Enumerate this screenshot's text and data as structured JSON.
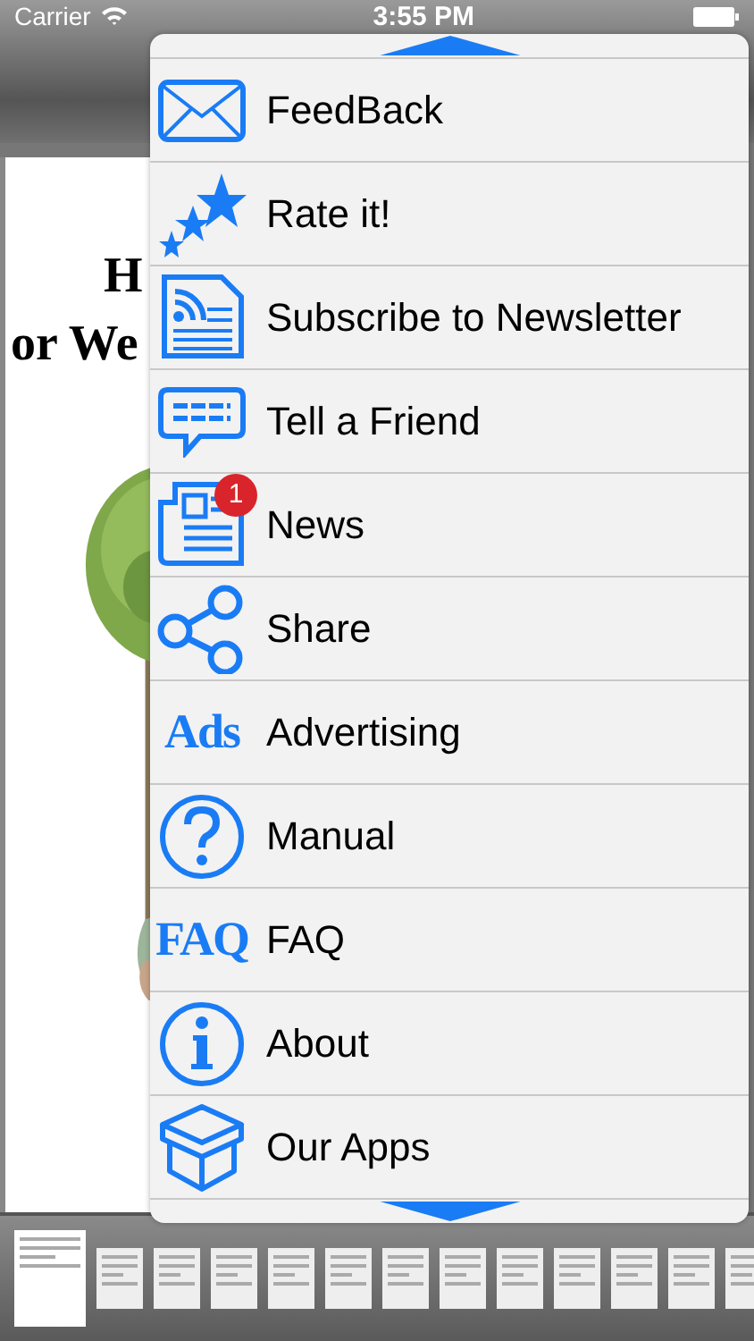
{
  "status_bar": {
    "carrier": "Carrier",
    "time": "3:55 PM"
  },
  "document": {
    "title_lines": [
      "H",
      "or We"
    ]
  },
  "menu": {
    "items": [
      {
        "label": "FeedBack"
      },
      {
        "label": "Rate it!"
      },
      {
        "label": "Subscribe to Newsletter"
      },
      {
        "label": "Tell a Friend"
      },
      {
        "label": "News",
        "badge": "1"
      },
      {
        "label": "Share"
      },
      {
        "label": "Advertising",
        "icon_text": "Ads"
      },
      {
        "label": "Manual"
      },
      {
        "label": "FAQ",
        "icon_text": "FAQ"
      },
      {
        "label": "About"
      },
      {
        "label": "Our Apps"
      }
    ]
  },
  "thumbnails": [
    {
      "selected": true
    },
    {
      "selected": false
    },
    {
      "selected": false
    },
    {
      "selected": false
    },
    {
      "selected": false
    },
    {
      "selected": false
    },
    {
      "selected": false
    },
    {
      "selected": false
    },
    {
      "selected": false
    },
    {
      "selected": false
    },
    {
      "selected": false
    },
    {
      "selected": false
    },
    {
      "selected": false
    }
  ]
}
